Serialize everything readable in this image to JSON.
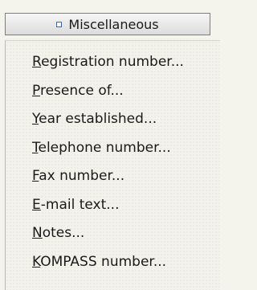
{
  "header": {
    "label": "Miscellaneous",
    "icon": "square-bullet-icon"
  },
  "menu": {
    "items": [
      {
        "first": "R",
        "rest": "egistration number..."
      },
      {
        "first": "P",
        "rest": "resence of..."
      },
      {
        "first": "Y",
        "rest": "ear established..."
      },
      {
        "first": "T",
        "rest": "elephone number..."
      },
      {
        "first": "F",
        "rest": "ax number..."
      },
      {
        "first": "E",
        "rest": "-mail text..."
      },
      {
        "first": "N",
        "rest": "otes..."
      },
      {
        "first": "K",
        "rest": "OMPASS number..."
      }
    ]
  }
}
